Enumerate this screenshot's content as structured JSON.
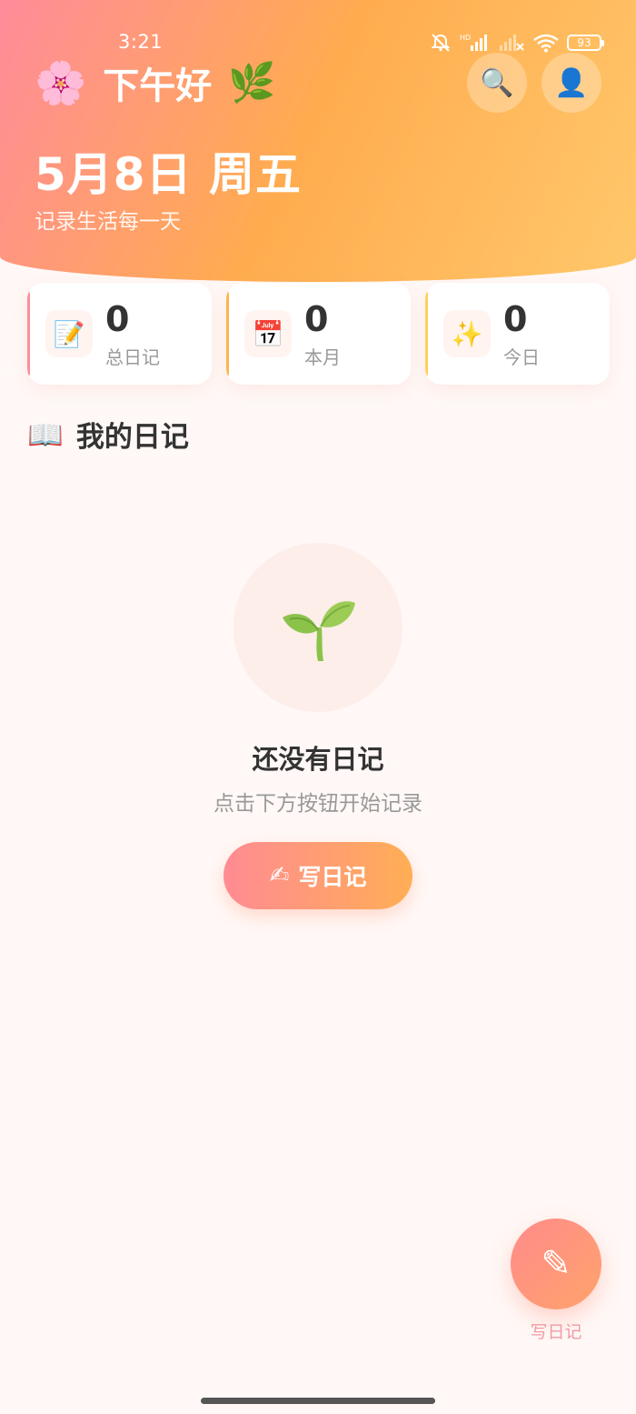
{
  "status_bar": {
    "time": "3:21",
    "battery": "93"
  },
  "header": {
    "flower_icon": "🌸",
    "greeting": "下午好",
    "leaf_icon": "🌿",
    "search_icon": "🔍",
    "profile_icon": "👤",
    "date": "5月8日 周五",
    "subtitle": "记录生活每一天"
  },
  "stats": [
    {
      "icon": "📝",
      "value": "0",
      "label": "总日记",
      "accent": "#ff8e9c"
    },
    {
      "icon": "📅",
      "value": "0",
      "label": "本月",
      "accent": "#ffb44c"
    },
    {
      "icon": "✨",
      "value": "0",
      "label": "今日",
      "accent": "#ffd05a"
    }
  ],
  "section": {
    "icon": "📖",
    "title": "我的日记"
  },
  "empty_state": {
    "title": "还没有日记",
    "subtitle": "点击下方按钮开始记录",
    "button_icon": "✍",
    "button_label": "写日记"
  },
  "fab": {
    "icon": "✎",
    "label": "写日记"
  },
  "colors": {
    "header_start": "#ff8b9a",
    "header_end": "#ffc86b",
    "background": "#fff8f6",
    "sprout_green": "#8bc34a"
  }
}
